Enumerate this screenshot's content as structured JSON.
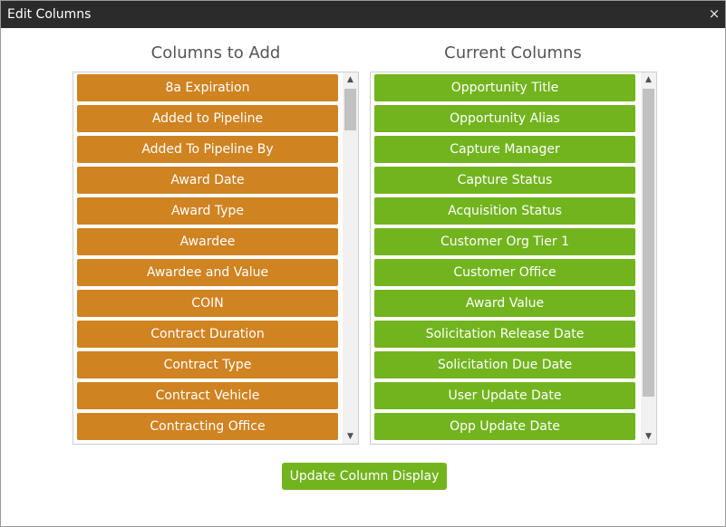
{
  "dialog": {
    "title": "Edit Columns",
    "close_icon": "close-icon",
    "close_glyph": "×"
  },
  "columns_to_add": {
    "heading": "Columns to Add",
    "item_color": "#cf8321",
    "items": [
      "8a Expiration",
      "Added to Pipeline",
      "Added To Pipeline By",
      "Award Date",
      "Award Type",
      "Awardee",
      "Awardee and Value",
      "COIN",
      "Contract Duration",
      "Contract Type",
      "Contract Vehicle",
      "Contracting Office"
    ]
  },
  "current_columns": {
    "heading": "Current Columns",
    "item_color": "#72b41e",
    "items": [
      "Opportunity Title",
      "Opportunity Alias",
      "Capture Manager",
      "Capture Status",
      "Acquisition Status",
      "Customer Org Tier 1",
      "Customer Office",
      "Award Value",
      "Solicitation Release Date",
      "Solicitation Due Date",
      "User Update Date",
      "Opp Update Date"
    ]
  },
  "scrollbar": {
    "up_icon": "scroll-up-arrow-icon",
    "down_icon": "scroll-down-arrow-icon",
    "up_glyph": "▲",
    "down_glyph": "▼"
  },
  "update_button": {
    "label": "Update Column Display",
    "color": "#72b41e"
  }
}
